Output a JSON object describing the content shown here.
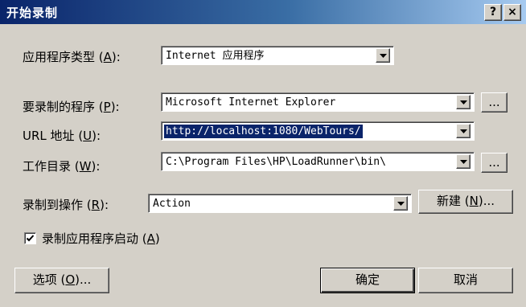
{
  "window": {
    "title": "开始录制",
    "help_button": "?",
    "close_button": "×"
  },
  "form": {
    "app_type": {
      "label": "应用程序类型",
      "accel_open": "(",
      "accel_key": "A",
      "accel_close": "):",
      "value": "Internet 应用程序"
    },
    "program": {
      "label": "要录制的程序",
      "accel_open": "(",
      "accel_key": "P",
      "accel_close": "):",
      "value": "Microsoft Internet Explorer",
      "browse": "..."
    },
    "url": {
      "label": "URL 地址",
      "accel_open": "(",
      "accel_key": "U",
      "accel_close": "):",
      "value": "http://localhost:1080/WebTours/"
    },
    "workdir": {
      "label": "工作目录",
      "accel_open": "(",
      "accel_key": "W",
      "accel_close": "):",
      "value": "C:\\Program Files\\HP\\LoadRunner\\bin\\",
      "browse": "..."
    },
    "record_to": {
      "label": "录制到操作",
      "accel_open": "(",
      "accel_key": "R",
      "accel_close": "):",
      "value": "Action",
      "new_button": "新建",
      "new_accel_open": "(",
      "new_accel_key": "N",
      "new_accel_close": ")..."
    },
    "record_startup": {
      "label": "录制应用程序启动",
      "accel_open": "(",
      "accel_key": "A",
      "accel_close": ")",
      "checked": true
    }
  },
  "buttons": {
    "options": {
      "label": "选项",
      "accel_open": "(",
      "accel_key": "O",
      "accel_close": ")..."
    },
    "ok": "确定",
    "cancel": "取消"
  }
}
